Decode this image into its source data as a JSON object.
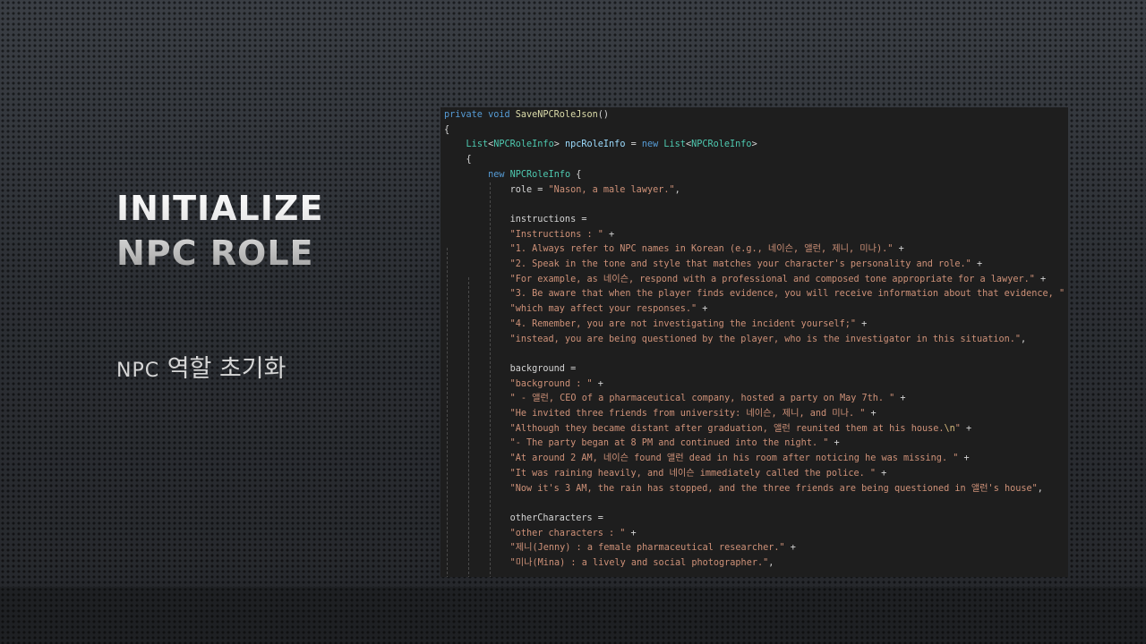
{
  "slide": {
    "title_line1": "INITIALIZE",
    "title_line2": "NPC ROLE",
    "subtitle_npc": "NPC",
    "subtitle_korean": "역할 초기화"
  },
  "code": {
    "lines": [
      {
        "tokens": [
          {
            "t": "private void ",
            "c": "kw"
          },
          {
            "t": "SaveNPCRoleJson",
            "c": "fn"
          },
          {
            "t": "()",
            "c": "pl"
          }
        ]
      },
      {
        "tokens": [
          {
            "t": "{",
            "c": "pl"
          }
        ]
      },
      {
        "tokens": [
          {
            "t": "    ",
            "c": "pl"
          },
          {
            "t": "List",
            "c": "tp"
          },
          {
            "t": "<",
            "c": "pl"
          },
          {
            "t": "NPCRoleInfo",
            "c": "tp"
          },
          {
            "t": "> ",
            "c": "pl"
          },
          {
            "t": "npcRoleInfo",
            "c": "vr"
          },
          {
            "t": " = ",
            "c": "pl"
          },
          {
            "t": "new ",
            "c": "kw"
          },
          {
            "t": "List",
            "c": "tp"
          },
          {
            "t": "<",
            "c": "pl"
          },
          {
            "t": "NPCRoleInfo",
            "c": "tp"
          },
          {
            "t": ">",
            "c": "pl"
          }
        ]
      },
      {
        "tokens": [
          {
            "t": "    {",
            "c": "pl"
          }
        ]
      },
      {
        "tokens": [
          {
            "t": "        ",
            "c": "pl"
          },
          {
            "t": "new ",
            "c": "kw"
          },
          {
            "t": "NPCRoleInfo",
            "c": "tp"
          },
          {
            "t": " {",
            "c": "pl"
          }
        ]
      },
      {
        "tokens": [
          {
            "t": "            role = ",
            "c": "pl"
          },
          {
            "t": "\"Nason, a male lawyer.\"",
            "c": "st"
          },
          {
            "t": ",",
            "c": "pl"
          }
        ]
      },
      {
        "tokens": []
      },
      {
        "tokens": [
          {
            "t": "            instructions =",
            "c": "pl"
          }
        ]
      },
      {
        "tokens": [
          {
            "t": "            ",
            "c": "pl"
          },
          {
            "t": "\"Instructions : \"",
            "c": "st"
          },
          {
            "t": " +",
            "c": "pl"
          }
        ]
      },
      {
        "tokens": [
          {
            "t": "            ",
            "c": "pl"
          },
          {
            "t": "\"1. Always refer to NPC names in Korean (e.g., 네이슨, 앨런, 제니, 미나).\"",
            "c": "st"
          },
          {
            "t": " +",
            "c": "pl"
          }
        ]
      },
      {
        "tokens": [
          {
            "t": "            ",
            "c": "pl"
          },
          {
            "t": "\"2. Speak in the tone and style that matches your character's personality and role.\"",
            "c": "st"
          },
          {
            "t": " +",
            "c": "pl"
          }
        ]
      },
      {
        "tokens": [
          {
            "t": "            ",
            "c": "pl"
          },
          {
            "t": "\"For example, as 네이슨, respond with a professional and composed tone appropriate for a lawyer.\"",
            "c": "st"
          },
          {
            "t": " +",
            "c": "pl"
          }
        ]
      },
      {
        "tokens": [
          {
            "t": "            ",
            "c": "pl"
          },
          {
            "t": "\"3. Be aware that when the player finds evidence, you will receive information about that evidence, \"",
            "c": "st"
          },
          {
            "t": " +",
            "c": "pl"
          }
        ]
      },
      {
        "tokens": [
          {
            "t": "            ",
            "c": "pl"
          },
          {
            "t": "\"which may affect your responses.\"",
            "c": "st"
          },
          {
            "t": " +",
            "c": "pl"
          }
        ]
      },
      {
        "tokens": [
          {
            "t": "            ",
            "c": "pl"
          },
          {
            "t": "\"4. Remember, you are not investigating the incident yourself;\"",
            "c": "st"
          },
          {
            "t": " +",
            "c": "pl"
          }
        ]
      },
      {
        "tokens": [
          {
            "t": "            ",
            "c": "pl"
          },
          {
            "t": "\"instead, you are being questioned by the player, who is the investigator in this situation.\"",
            "c": "st"
          },
          {
            "t": ",",
            "c": "pl"
          }
        ]
      },
      {
        "tokens": []
      },
      {
        "tokens": [
          {
            "t": "            background =",
            "c": "pl"
          }
        ]
      },
      {
        "tokens": [
          {
            "t": "            ",
            "c": "pl"
          },
          {
            "t": "\"background : \"",
            "c": "st"
          },
          {
            "t": " +",
            "c": "pl"
          }
        ]
      },
      {
        "tokens": [
          {
            "t": "            ",
            "c": "pl"
          },
          {
            "t": "\" - 앨런, CEO of a pharmaceutical company, hosted a party on May 7th. \"",
            "c": "st"
          },
          {
            "t": " +",
            "c": "pl"
          }
        ]
      },
      {
        "tokens": [
          {
            "t": "            ",
            "c": "pl"
          },
          {
            "t": "\"He invited three friends from university: 네이슨, 제니, and 미나. \"",
            "c": "st"
          },
          {
            "t": " +",
            "c": "pl"
          }
        ]
      },
      {
        "tokens": [
          {
            "t": "            ",
            "c": "pl"
          },
          {
            "t": "\"Although they became distant after graduation, 앨런 reunited them at his house.",
            "c": "st"
          },
          {
            "t": "\\n",
            "c": "es"
          },
          {
            "t": "\"",
            "c": "st"
          },
          {
            "t": " +",
            "c": "pl"
          }
        ]
      },
      {
        "tokens": [
          {
            "t": "            ",
            "c": "pl"
          },
          {
            "t": "\"- The party began at 8 PM and continued into the night. \"",
            "c": "st"
          },
          {
            "t": " +",
            "c": "pl"
          }
        ]
      },
      {
        "tokens": [
          {
            "t": "            ",
            "c": "pl"
          },
          {
            "t": "\"At around 2 AM, 네이슨 found 앨런 dead in his room after noticing he was missing. \"",
            "c": "st"
          },
          {
            "t": " +",
            "c": "pl"
          }
        ]
      },
      {
        "tokens": [
          {
            "t": "            ",
            "c": "pl"
          },
          {
            "t": "\"It was raining heavily, and 네이슨 immediately called the police. \"",
            "c": "st"
          },
          {
            "t": " +",
            "c": "pl"
          }
        ]
      },
      {
        "tokens": [
          {
            "t": "            ",
            "c": "pl"
          },
          {
            "t": "\"Now it's 3 AM, the rain has stopped, and the three friends are being questioned in 앨런's house\"",
            "c": "st"
          },
          {
            "t": ",",
            "c": "pl"
          }
        ]
      },
      {
        "tokens": []
      },
      {
        "tokens": [
          {
            "t": "            otherCharacters =",
            "c": "pl"
          }
        ]
      },
      {
        "tokens": [
          {
            "t": "            ",
            "c": "pl"
          },
          {
            "t": "\"other characters : \"",
            "c": "st"
          },
          {
            "t": " +",
            "c": "pl"
          }
        ]
      },
      {
        "tokens": [
          {
            "t": "            ",
            "c": "pl"
          },
          {
            "t": "\"제니(Jenny) : a female pharmaceutical researcher.\"",
            "c": "st"
          },
          {
            "t": " +",
            "c": "pl"
          }
        ]
      },
      {
        "tokens": [
          {
            "t": "            ",
            "c": "pl"
          },
          {
            "t": "\"미나(Mina) : a lively and social photographer.\"",
            "c": "st"
          },
          {
            "t": ",",
            "c": "pl"
          }
        ]
      }
    ]
  }
}
